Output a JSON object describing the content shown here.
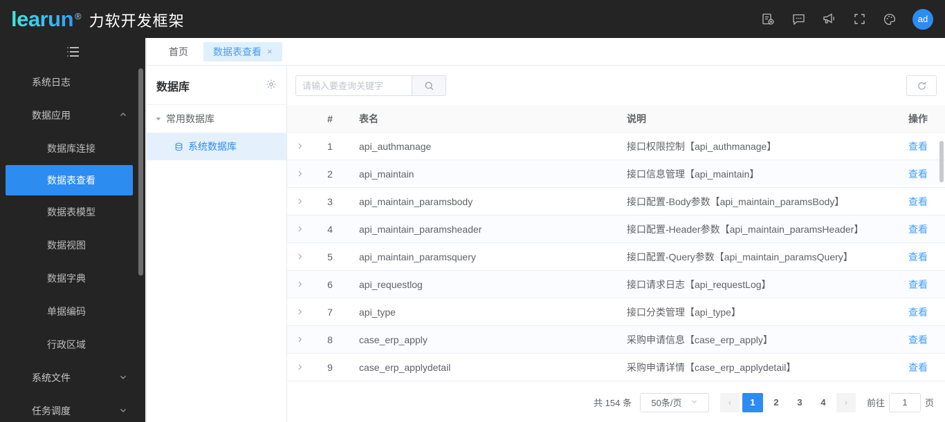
{
  "header": {
    "brand_text": "learun",
    "brand_reg": "®",
    "brand_cn": "力软开发框架",
    "brand_color": "#35c9ec",
    "accent_color": "#2d8cf0",
    "icons": [
      {
        "name": "file-add-icon",
        "label": "file-add"
      },
      {
        "name": "chat-icon",
        "label": "chat"
      },
      {
        "name": "megaphone-icon",
        "label": "announcement"
      },
      {
        "name": "fullscreen-icon",
        "label": "fullscreen"
      },
      {
        "name": "palette-icon",
        "label": "theme"
      }
    ],
    "avatar_text": "ad"
  },
  "sidebar": {
    "toggle_icon": "menu-fold-icon",
    "items": [
      {
        "label": "系统日志",
        "level": 0,
        "caret": "",
        "active": false
      },
      {
        "label": "数据应用",
        "level": 0,
        "caret": "up",
        "active": false
      },
      {
        "label": "数据库连接",
        "level": 1,
        "caret": "",
        "active": false
      },
      {
        "label": "数据表查看",
        "level": 1,
        "caret": "",
        "active": true
      },
      {
        "label": "数据表模型",
        "level": 1,
        "caret": "",
        "active": false
      },
      {
        "label": "数据视图",
        "level": 1,
        "caret": "",
        "active": false
      },
      {
        "label": "数据字典",
        "level": 1,
        "caret": "",
        "active": false
      },
      {
        "label": "单据编码",
        "level": 1,
        "caret": "",
        "active": false
      },
      {
        "label": "行政区域",
        "level": 1,
        "caret": "",
        "active": false
      },
      {
        "label": "系统文件",
        "level": 0,
        "caret": "down",
        "active": false
      },
      {
        "label": "任务调度",
        "level": 0,
        "caret": "down",
        "active": false
      }
    ]
  },
  "tabs": [
    {
      "label": "首页",
      "active": false,
      "closable": false
    },
    {
      "label": "数据表查看",
      "active": true,
      "closable": true,
      "close_glyph": "×"
    }
  ],
  "db_panel": {
    "title": "数据库",
    "gear_icon": "gear-icon",
    "tree": [
      {
        "label": "常用数据库",
        "level": 0,
        "selected": false,
        "arrow": "▾"
      },
      {
        "label": "系统数据库",
        "level": 1,
        "selected": true,
        "icon": "database-icon"
      }
    ]
  },
  "toolbar": {
    "search_placeholder": "请输入要查询关键字",
    "search_value": "",
    "search_icon": "search-icon",
    "refresh_icon": "refresh-icon"
  },
  "table": {
    "columns": [
      "#",
      "表名",
      "说明",
      "操作"
    ],
    "action_label": "查看",
    "rows": [
      {
        "idx": "1",
        "name": "api_authmanage",
        "desc": "接口权限控制【api_authmanage】"
      },
      {
        "idx": "2",
        "name": "api_maintain",
        "desc": "接口信息管理【api_maintain】"
      },
      {
        "idx": "3",
        "name": "api_maintain_paramsbody",
        "desc": "接口配置-Body参数【api_maintain_paramsBody】"
      },
      {
        "idx": "4",
        "name": "api_maintain_paramsheader",
        "desc": "接口配置-Header参数【api_maintain_paramsHeader】"
      },
      {
        "idx": "5",
        "name": "api_maintain_paramsquery",
        "desc": "接口配置-Query参数【api_maintain_paramsQuery】"
      },
      {
        "idx": "6",
        "name": "api_requestlog",
        "desc": "接口请求日志【api_requestLog】"
      },
      {
        "idx": "7",
        "name": "api_type",
        "desc": "接口分类管理【api_type】"
      },
      {
        "idx": "8",
        "name": "case_erp_apply",
        "desc": "采购申请信息【case_erp_apply】"
      },
      {
        "idx": "9",
        "name": "case_erp_applydetail",
        "desc": "采购申请详情【case_erp_applydetail】"
      }
    ]
  },
  "pagination": {
    "total_text": "共 154 条",
    "page_size_label": "50条/页",
    "prev_glyph": "‹",
    "next_glyph": "›",
    "pages": [
      "1",
      "2",
      "3",
      "4"
    ],
    "current_page": "1",
    "jump_prefix": "前往",
    "jump_value": "1",
    "jump_suffix": "页"
  }
}
